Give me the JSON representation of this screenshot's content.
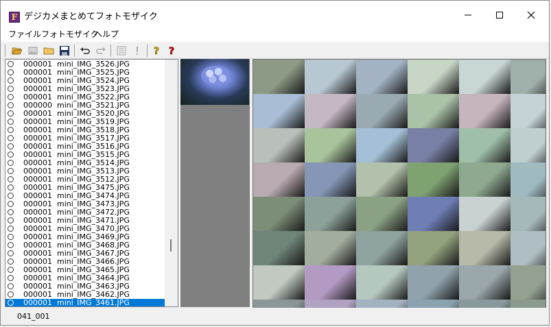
{
  "window": {
    "title": "デジカメまとめてフォトモザイク",
    "app_icon_letter": "F"
  },
  "menu": [
    "ファイル",
    "フォトモザイク",
    "ヘルプ"
  ],
  "toolbar_icons": [
    {
      "name": "open-folder-icon",
      "color": "#d9a521"
    },
    {
      "name": "image-icon",
      "color": "#9a9a9a"
    },
    {
      "name": "folder-icon",
      "color": "#e8b84a"
    },
    {
      "name": "save-icon",
      "color": "#1f2f5a"
    },
    {
      "name": "undo-icon",
      "color": "#2a2a2a"
    },
    {
      "name": "redo-icon",
      "color": "#a8a8a8"
    },
    {
      "name": "list-icon",
      "color": "#a8a8a8"
    },
    {
      "name": "exclamation-icon",
      "color": "#a8a8a8"
    },
    {
      "name": "help-icon",
      "color": "#d4b000"
    },
    {
      "name": "context-help-icon",
      "color": "#c00000"
    }
  ],
  "files": [
    {
      "count": "000001",
      "name": "mini_IMG_3526.JPG"
    },
    {
      "count": "000001",
      "name": "mini_IMG_3525.JPG"
    },
    {
      "count": "000001",
      "name": "mini_IMG_3524.JPG"
    },
    {
      "count": "000001",
      "name": "mini_IMG_3523.JPG"
    },
    {
      "count": "000001",
      "name": "mini_IMG_3522.JPG"
    },
    {
      "count": "000000",
      "name": "mini_IMG_3521.JPG"
    },
    {
      "count": "000001",
      "name": "mini_IMG_3520.JPG"
    },
    {
      "count": "000001",
      "name": "mini_IMG_3519.JPG"
    },
    {
      "count": "000001",
      "name": "mini_IMG_3518.JPG"
    },
    {
      "count": "000001",
      "name": "mini_IMG_3517.JPG"
    },
    {
      "count": "000001",
      "name": "mini_IMG_3516.JPG"
    },
    {
      "count": "000001",
      "name": "mini_IMG_3515.JPG"
    },
    {
      "count": "000001",
      "name": "mini_IMG_3514.JPG"
    },
    {
      "count": "000001",
      "name": "mini_IMG_3513.JPG"
    },
    {
      "count": "000001",
      "name": "mini_IMG_3512.JPG"
    },
    {
      "count": "000001",
      "name": "mini_IMG_3475.JPG"
    },
    {
      "count": "000001",
      "name": "mini_IMG_3474.JPG"
    },
    {
      "count": "000001",
      "name": "mini_IMG_3473.JPG"
    },
    {
      "count": "000001",
      "name": "mini_IMG_3472.JPG"
    },
    {
      "count": "000001",
      "name": "mini_IMG_3471.JPG"
    },
    {
      "count": "000001",
      "name": "mini_IMG_3470.JPG"
    },
    {
      "count": "000001",
      "name": "mini_IMG_3469.JPG"
    },
    {
      "count": "000001",
      "name": "mini_IMG_3468.JPG"
    },
    {
      "count": "000001",
      "name": "mini_IMG_3467.JPG"
    },
    {
      "count": "000001",
      "name": "mini_IMG_3466.JPG"
    },
    {
      "count": "000001",
      "name": "mini_IMG_3465.JPG"
    },
    {
      "count": "000001",
      "name": "mini_IMG_3464.JPG"
    },
    {
      "count": "000001",
      "name": "mini_IMG_3463.JPG"
    },
    {
      "count": "000001",
      "name": "mini_IMG_3462.JPG"
    },
    {
      "count": "000001",
      "name": "mini_IMG_3461.JPG",
      "selected": true
    }
  ],
  "mosaic_tiles": [
    [
      "#8d9a86",
      "#b8c8d2",
      "#a3b3c4",
      "#c8d6c6",
      "#c9d6d6",
      "#9fb0aa"
    ],
    [
      "#a9bdd4",
      "#c4b8c4",
      "#9aaab2",
      "#aac2a8",
      "#c6b5be",
      "#c5d3d6"
    ],
    [
      "#b9c0b9",
      "#a9c39c",
      "#a5bfd6",
      "#7880a6",
      "#9fbfa8",
      "#bfcfcf"
    ],
    [
      "#b9a9b0",
      "#8596b6",
      "#b2c1ac",
      "#7fa271",
      "#8fa990",
      "#9fbac0"
    ],
    [
      "#7c8e78",
      "#8ca19a",
      "#8aa184",
      "#6f7fb6",
      "#c9d1d1",
      "#a6b9ba"
    ],
    [
      "#6f8578",
      "#a2ad9e",
      "#8fa3a0",
      "#93a37f",
      "#b7b9a9",
      "#aebec2"
    ],
    [
      "#c1c9c0",
      "#b39ac3",
      "#b5c8c0",
      "#90a2ac",
      "#9aa7ab",
      "#93a191"
    ],
    [
      "#8a9698",
      "#b1a2c4",
      "#a3b2c0",
      "#8aa3b0",
      "#8a9a9c",
      "#8a9a8d"
    ]
  ],
  "status": {
    "text": "041_001"
  }
}
